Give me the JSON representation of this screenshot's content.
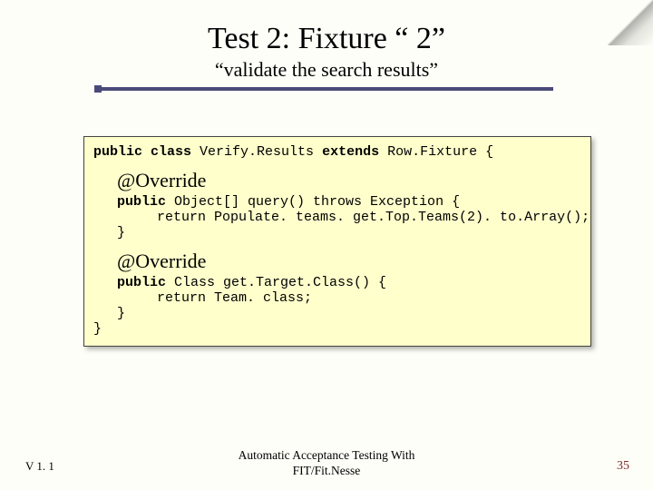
{
  "title": "Test 2: Fixture “ 2”",
  "subtitle": "“validate the search results”",
  "code": {
    "class_decl_pre": "public class ",
    "class_name": "Verify.Results",
    "class_decl_mid": " extends ",
    "class_extends": "Row.Fixture {",
    "override1": "@Override",
    "m1_sig_pre": "public ",
    "m1_sig_rest": "Object[] query() throws Exception {",
    "m1_body": "return Populate. teams. get.Top.Teams(2). to.Array();",
    "m1_close": "}",
    "override2": "@Override",
    "m2_sig_pre": "public ",
    "m2_sig_rest": "Class get.Target.Class() {",
    "m2_body": "return Team. class;",
    "m2_close": "}",
    "class_close": "}"
  },
  "footer": {
    "version": "V 1. 1",
    "title_line1": "Automatic Acceptance Testing With",
    "title_line2": "FIT/Fit.Nesse",
    "page": "35"
  }
}
